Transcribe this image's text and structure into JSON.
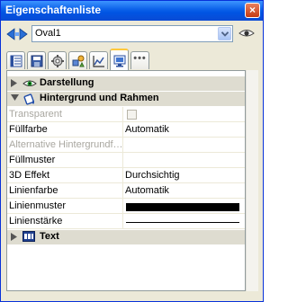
{
  "window": {
    "title": "Eigenschaftenliste",
    "close_glyph": "×"
  },
  "selector": {
    "value": "Oval1",
    "nav_icon": "nav-arrows-icon",
    "eye_icon": "eye-icon"
  },
  "tabs": [
    {
      "icon": "format-icon",
      "active": false
    },
    {
      "icon": "data-icon",
      "active": false
    },
    {
      "icon": "events-icon",
      "active": false
    },
    {
      "icon": "shapes-icon",
      "active": false
    },
    {
      "icon": "chart-icon",
      "active": false
    },
    {
      "icon": "display-icon",
      "active": true
    },
    {
      "icon": "more-icon",
      "label": "•••",
      "active": false
    }
  ],
  "groups": {
    "darstellung": {
      "label": "Darstellung",
      "expanded": false
    },
    "hintergrund": {
      "label": "Hintergrund und Rahmen",
      "expanded": true
    },
    "text": {
      "label": "Text",
      "expanded": false
    }
  },
  "properties": [
    {
      "name": "Transparent",
      "disabled": true,
      "kind": "checkbox",
      "value": ""
    },
    {
      "name": "Füllfarbe",
      "disabled": false,
      "kind": "text",
      "value": "Automatik"
    },
    {
      "name": "Alternative Hintergrundf…",
      "disabled": true,
      "kind": "text",
      "value": ""
    },
    {
      "name": "Füllmuster",
      "disabled": false,
      "kind": "text",
      "value": ""
    },
    {
      "name": "3D Effekt",
      "disabled": false,
      "kind": "text",
      "value": "Durchsichtig"
    },
    {
      "name": "Linienfarbe",
      "disabled": false,
      "kind": "text",
      "value": "Automatik"
    },
    {
      "name": "Linienmuster",
      "disabled": false,
      "kind": "swatch",
      "value": ""
    },
    {
      "name": "Linienstärke",
      "disabled": false,
      "kind": "line",
      "value": ""
    }
  ],
  "colors": {
    "titlebar": "#0054e3",
    "group_bg": "#dedcd0",
    "active_tab_accent": "#ffc83c",
    "disabled_text": "#a9a7a0"
  }
}
